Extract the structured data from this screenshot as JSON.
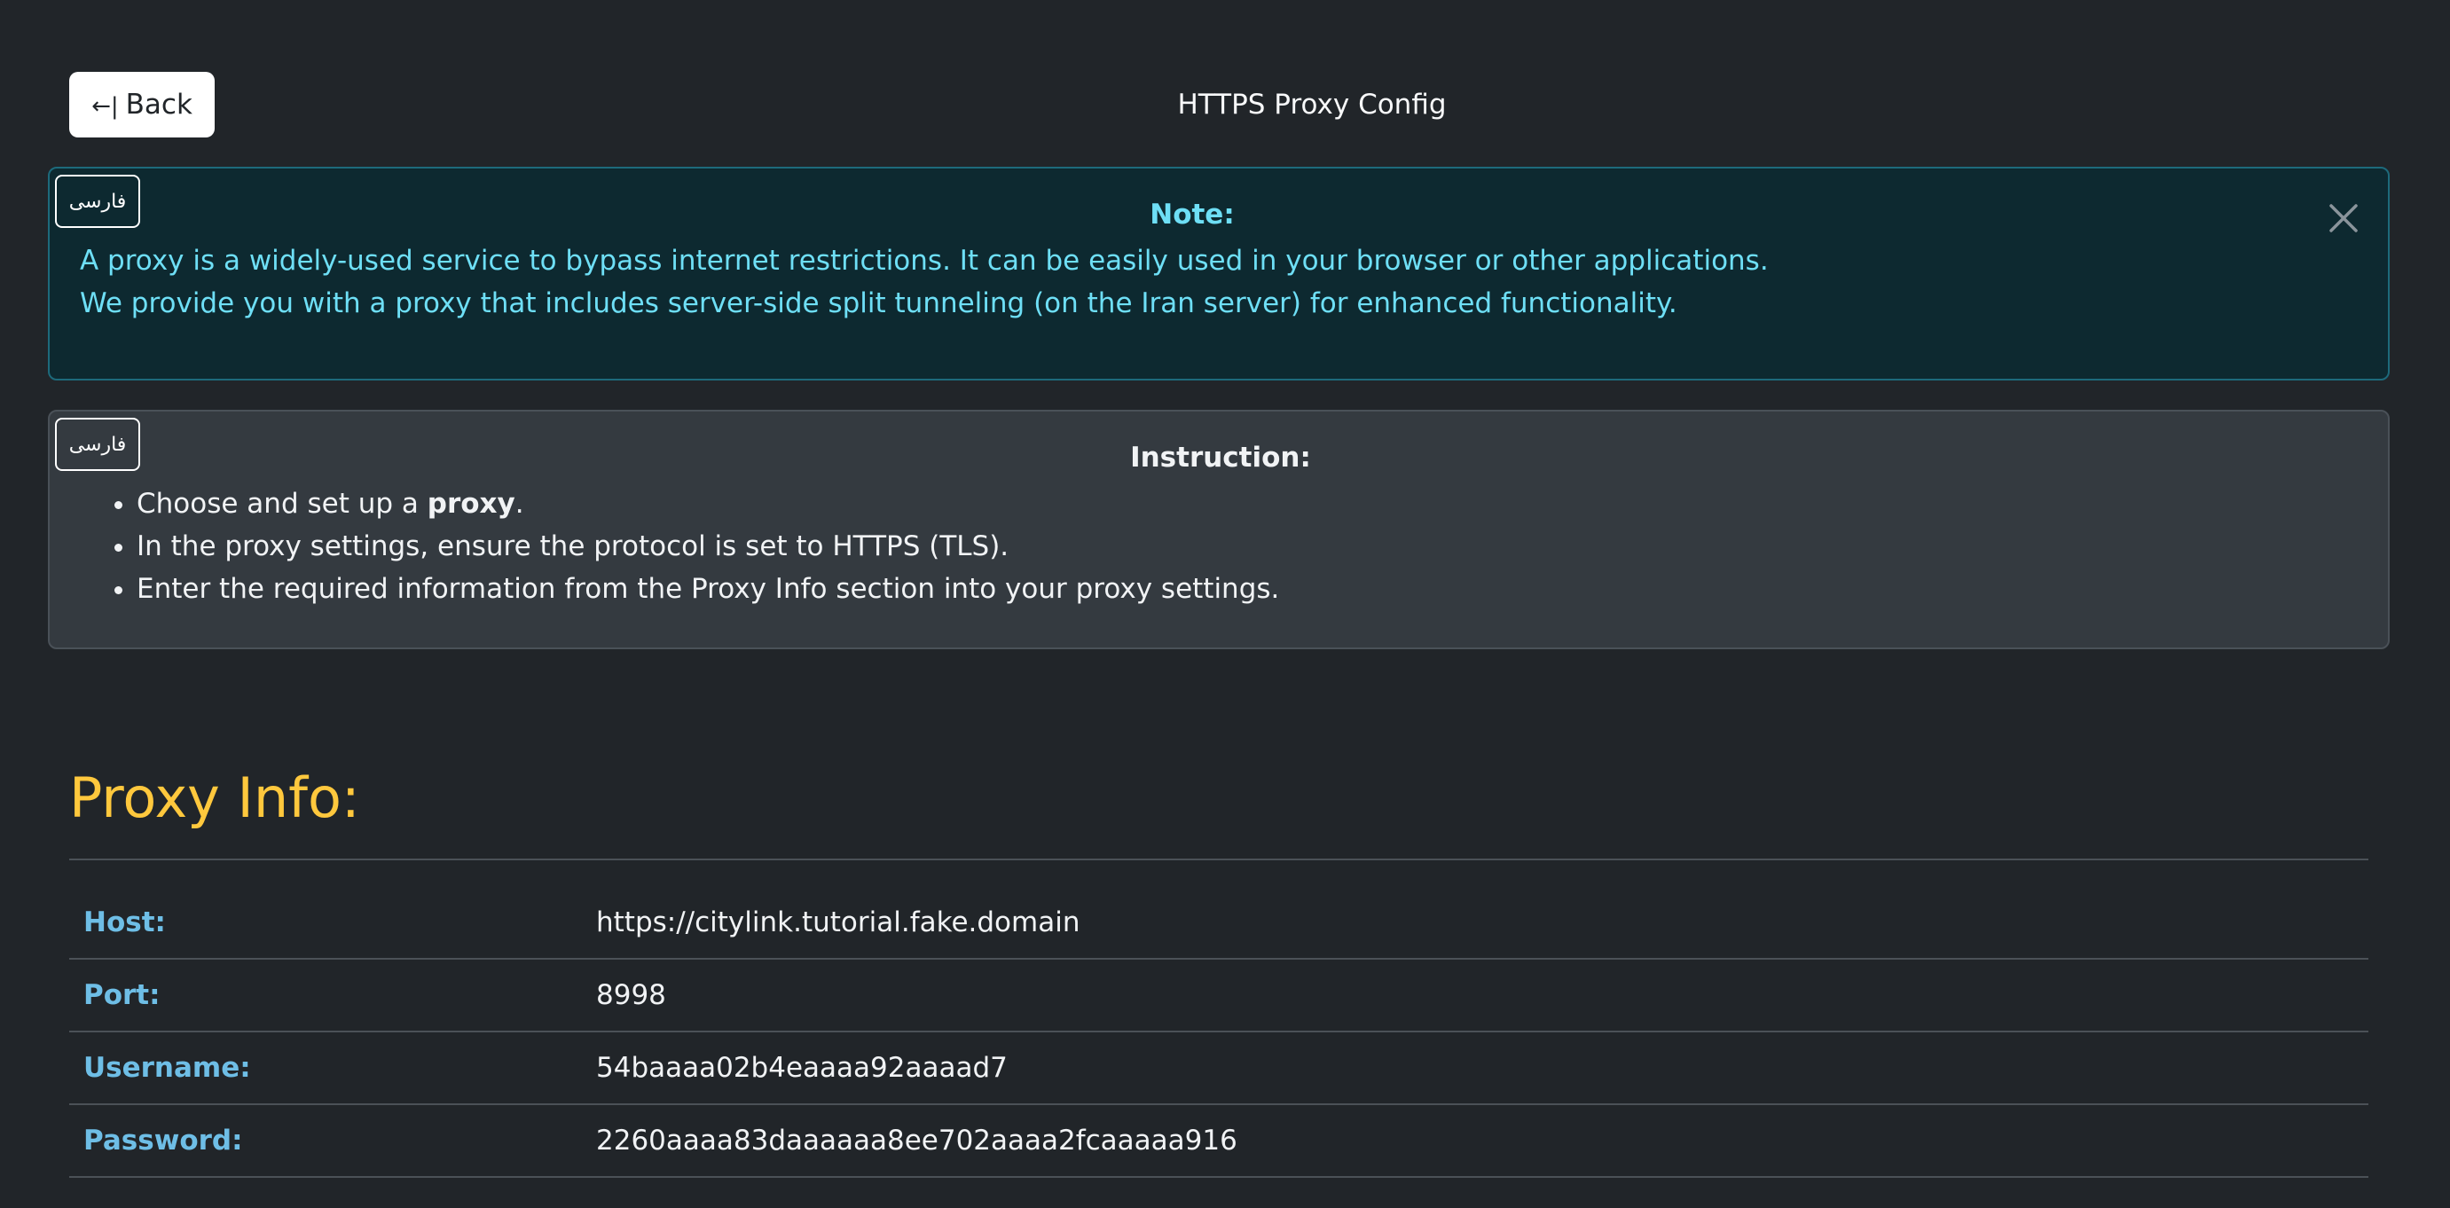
{
  "header": {
    "back_label": "Back",
    "back_arrow": "←|",
    "title": "HTTPS Proxy Config"
  },
  "note": {
    "lang_button": "فارسی",
    "heading": "Note:",
    "lines": [
      "A proxy is a widely-used service to bypass internet restrictions. It can be easily used in your browser or other applications.",
      "We provide you with a proxy that includes server-side split tunneling (on the Iran server) for enhanced functionality."
    ]
  },
  "instruction": {
    "lang_button": "فارسی",
    "heading": "Instruction:",
    "item1_prefix": "Choose and set up a ",
    "item1_bold": "proxy",
    "item1_suffix": ".",
    "item2": "In the proxy settings, ensure the protocol is set to HTTPS (TLS).",
    "item3": "Enter the required information from the Proxy Info section into your proxy settings."
  },
  "proxy_info": {
    "title": "Proxy Info:",
    "rows": [
      {
        "label": "Host:",
        "value": "https://citylink.tutorial.fake.domain"
      },
      {
        "label": "Port:",
        "value": "8998"
      },
      {
        "label": "Username:",
        "value": "54baaaa02b4eaaaa92aaaad7"
      },
      {
        "label": "Password:",
        "value": "2260aaaa83daaaaaa8ee702aaaa2fcaaaaa916"
      }
    ]
  },
  "colors": {
    "background": "#212529",
    "note_bg": "#0d2930",
    "note_text": "#6edff6",
    "accent_title": "#ffc83d",
    "label_blue": "#6ebee6"
  }
}
